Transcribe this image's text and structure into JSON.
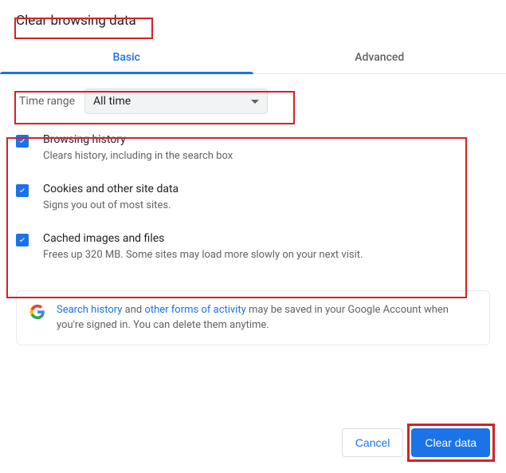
{
  "title": "Clear browsing data",
  "tabs": {
    "basic": "Basic",
    "advanced": "Advanced"
  },
  "time": {
    "label": "Time range",
    "selected": "All time"
  },
  "items": [
    {
      "title": "Browsing history",
      "desc": "Clears history, including in the search box"
    },
    {
      "title": "Cookies and other site data",
      "desc": "Signs you out of most sites."
    },
    {
      "title": "Cached images and files",
      "desc": "Frees up 320 MB. Some sites may load more slowly on your next visit."
    }
  ],
  "info": {
    "link1": "Search history",
    "mid1": " and ",
    "link2": "other forms of activity",
    "rest": " may be saved in your Google Account when you're signed in. You can delete them anytime."
  },
  "buttons": {
    "cancel": "Cancel",
    "confirm": "Clear data"
  }
}
